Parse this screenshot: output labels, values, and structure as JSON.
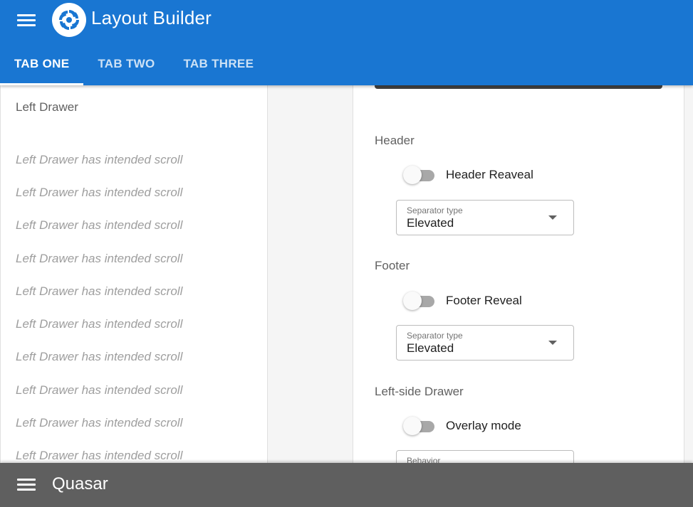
{
  "header": {
    "menu_icon": "menu-icon",
    "logo_icon": "quasar-logo",
    "title": "Layout Builder",
    "color": "#1976d2"
  },
  "tabs": [
    {
      "label": "TAB ONE",
      "active": true
    },
    {
      "label": "TAB TWO",
      "active": false
    },
    {
      "label": "TAB THREE",
      "active": false
    }
  ],
  "drawer": {
    "title": "Left Drawer",
    "items": [
      "Left Drawer has intended scroll",
      "Left Drawer has intended scroll",
      "Left Drawer has intended scroll",
      "Left Drawer has intended scroll",
      "Left Drawer has intended scroll",
      "Left Drawer has intended scroll",
      "Left Drawer has intended scroll",
      "Left Drawer has intended scroll",
      "Left Drawer has intended scroll",
      "Left Drawer has intended scroll"
    ]
  },
  "panel": {
    "header_section": {
      "title": "Header",
      "toggle_label": "Header Reaveal",
      "toggle_on": false,
      "select_label": "Separator type",
      "select_value": "Elevated"
    },
    "footer_section": {
      "title": "Footer",
      "toggle_label": "Footer Reveal",
      "toggle_on": false,
      "select_label": "Separator type",
      "select_value": "Elevated"
    },
    "left_drawer_section": {
      "title": "Left-side Drawer",
      "toggle_label": "Overlay mode",
      "toggle_on": false,
      "select_label": "Behavior"
    }
  },
  "footer": {
    "menu_icon": "menu-icon",
    "title": "Quasar",
    "color": "#5f5f5f"
  }
}
